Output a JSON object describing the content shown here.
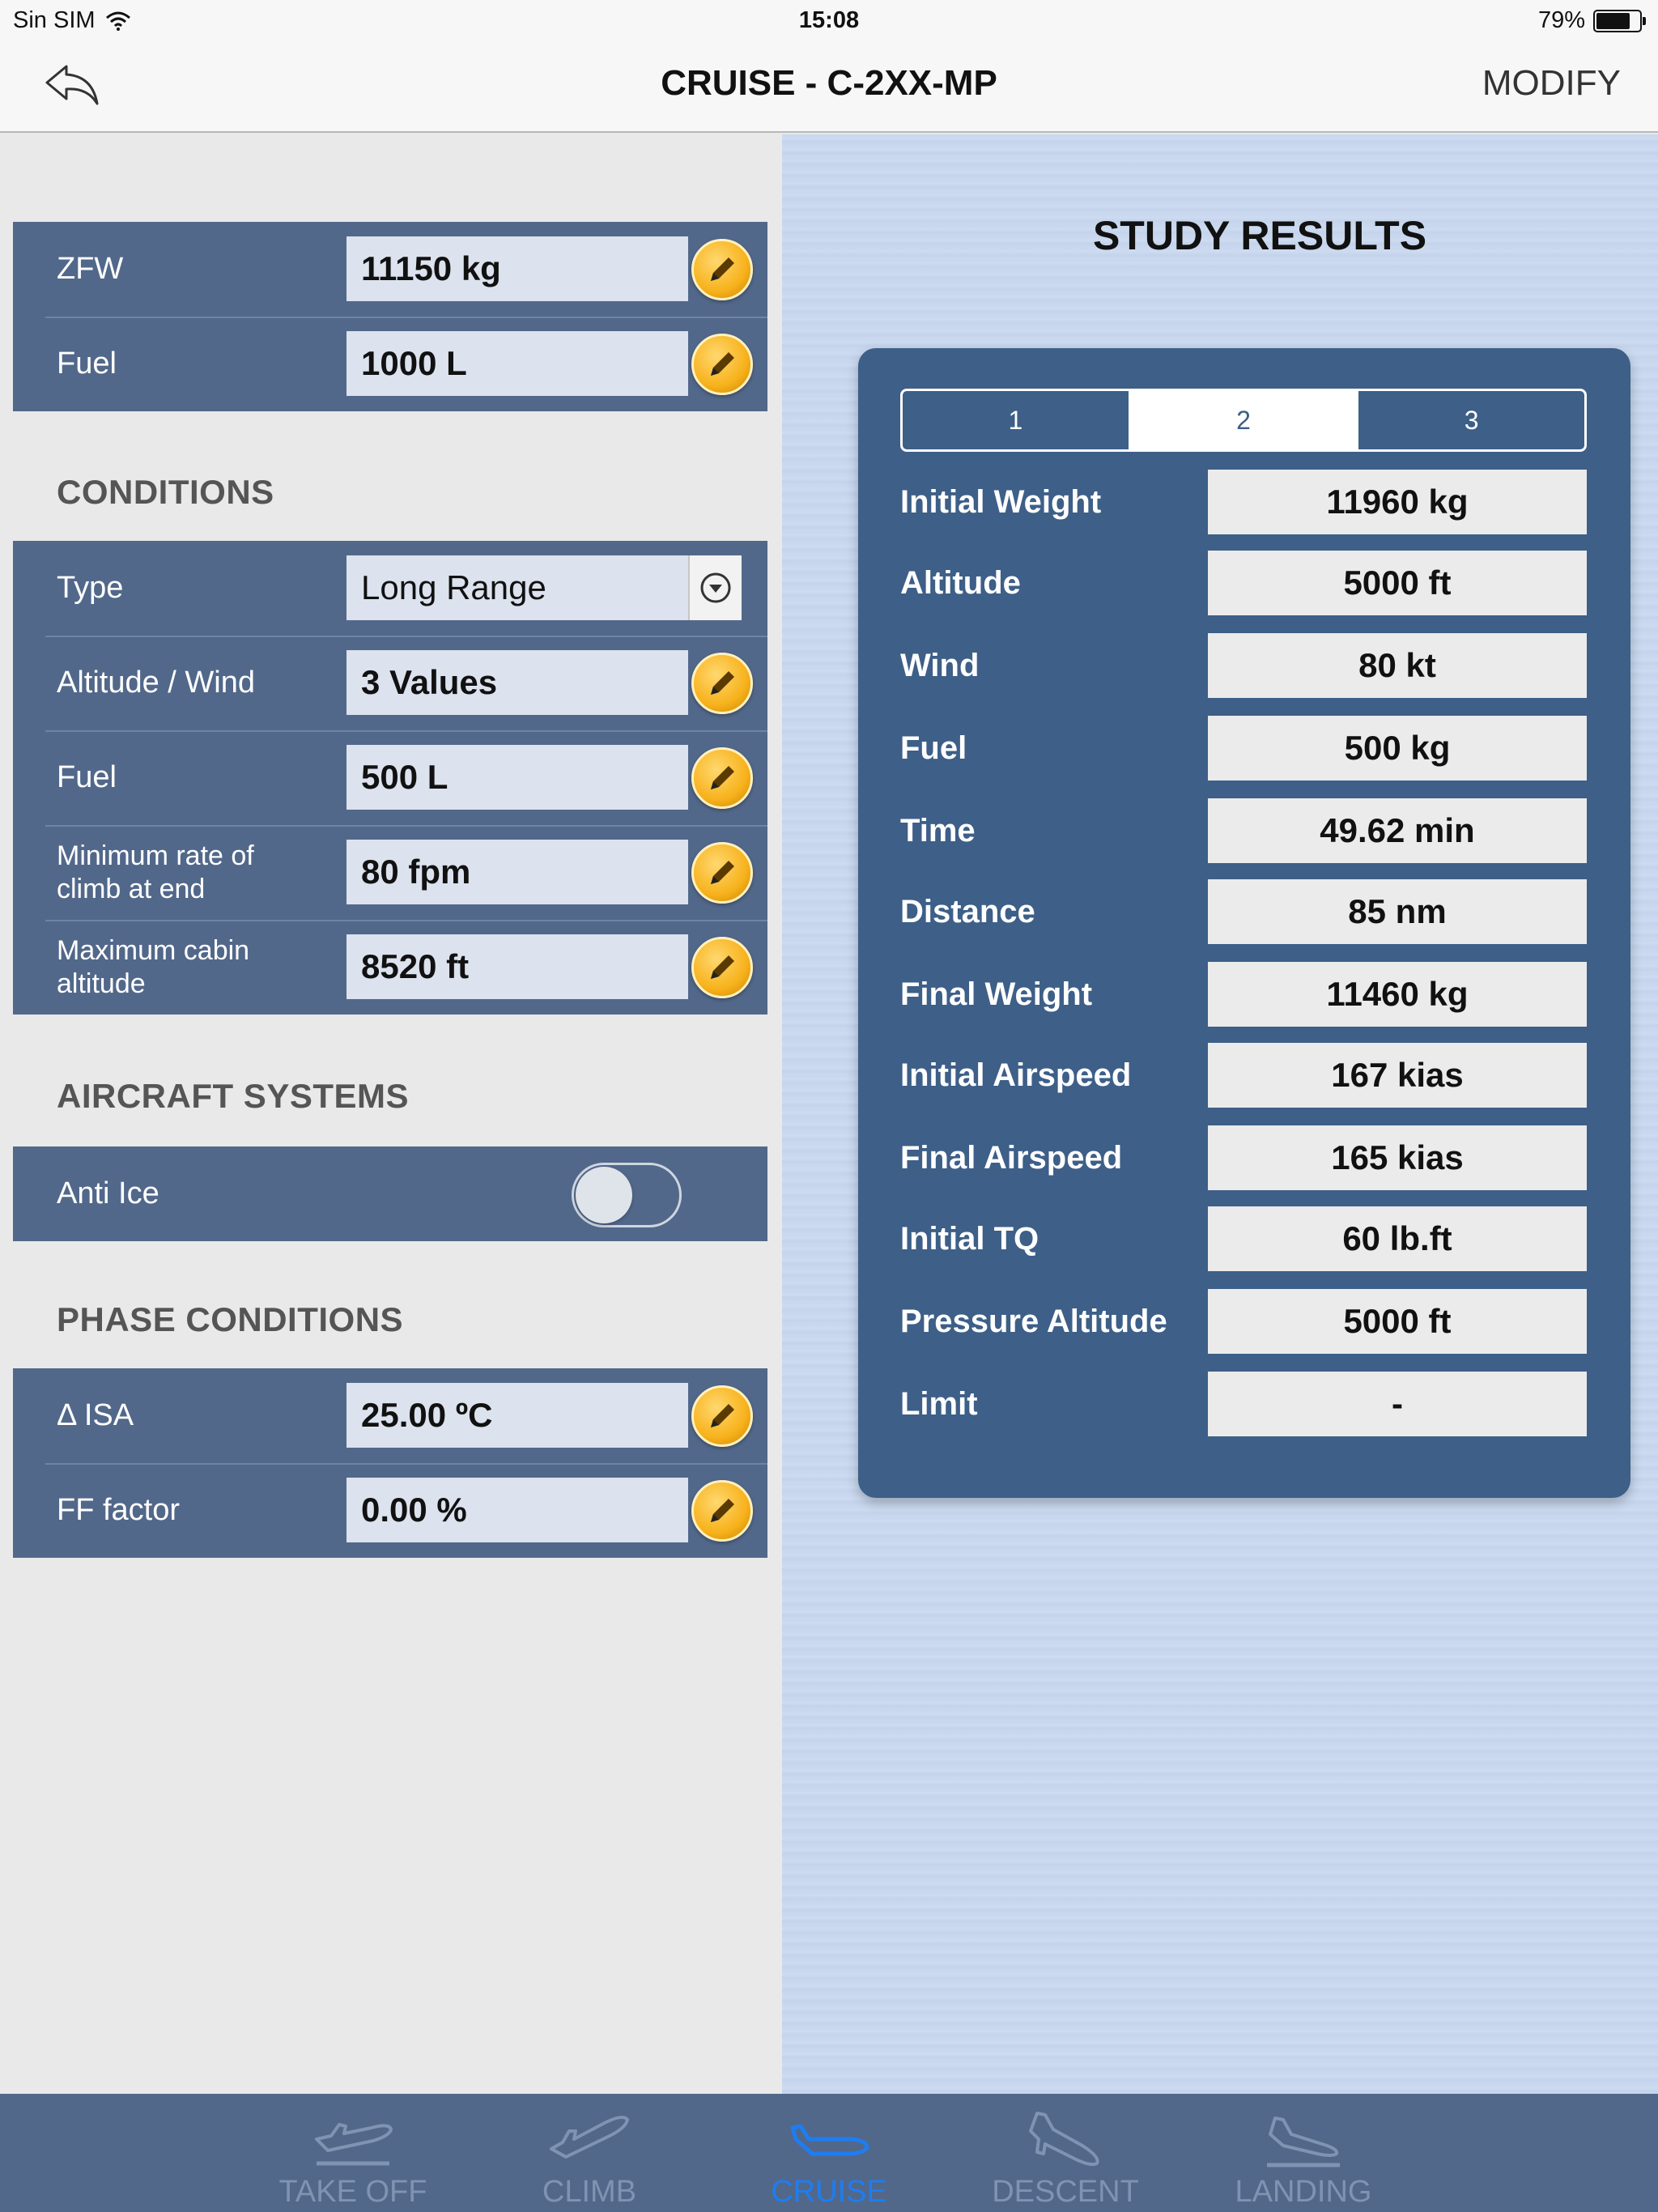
{
  "status": {
    "carrier": "Sin SIM",
    "time": "15:08",
    "battery": "79%",
    "battery_level": 0.79
  },
  "nav": {
    "title": "CRUISE - C-2XX-MP",
    "modify": "MODIFY"
  },
  "top_group": [
    {
      "label": "ZFW",
      "value": "11150 kg"
    },
    {
      "label": "Fuel",
      "value": "1000 L"
    }
  ],
  "conditions": {
    "title": "CONDITIONS",
    "type": {
      "label": "Type",
      "value": "Long Range"
    },
    "rows": [
      {
        "label": "Altitude / Wind",
        "value": "3 Values"
      },
      {
        "label": "Fuel",
        "value": "500 L"
      },
      {
        "label": "Minimum rate of climb at end",
        "value": "80 fpm"
      },
      {
        "label": "Maximum cabin altitude",
        "value": "8520 ft"
      }
    ]
  },
  "systems": {
    "title": "AIRCRAFT SYSTEMS",
    "anti_ice": {
      "label": "Anti Ice",
      "on": false
    }
  },
  "phase": {
    "title": "PHASE CONDITIONS",
    "rows": [
      {
        "label": "Δ ISA",
        "value": "25.00 ºC"
      },
      {
        "label": "FF factor",
        "value": "0.00 %"
      }
    ]
  },
  "results": {
    "title": "STUDY RESULTS",
    "segments": [
      "1",
      "2",
      "3"
    ],
    "selected_segment": "2",
    "rows": [
      {
        "label": "Initial Weight",
        "value": "11960 kg"
      },
      {
        "label": "Altitude",
        "value": "5000 ft"
      },
      {
        "label": "Wind",
        "value": "80 kt"
      },
      {
        "label": "Fuel",
        "value": "500 kg"
      },
      {
        "label": "Time",
        "value": "49.62 min"
      },
      {
        "label": "Distance",
        "value": "85 nm"
      },
      {
        "label": "Final Weight",
        "value": "11460 kg"
      },
      {
        "label": "Initial Airspeed",
        "value": "167 kias"
      },
      {
        "label": "Final Airspeed",
        "value": "165 kias"
      },
      {
        "label": "Initial TQ",
        "value": "60 lb.ft"
      },
      {
        "label": "Pressure Altitude",
        "value": "5000 ft"
      },
      {
        "label": "Limit",
        "value": "-"
      }
    ]
  },
  "tabs": [
    {
      "label": "TAKE OFF",
      "icon": "takeoff-icon"
    },
    {
      "label": "CLIMB",
      "icon": "climb-icon"
    },
    {
      "label": "CRUISE",
      "icon": "cruise-icon",
      "active": true
    },
    {
      "label": "DESCENT",
      "icon": "descent-icon"
    },
    {
      "label": "LANDING",
      "icon": "landing-icon"
    }
  ],
  "colors": {
    "panel": "#52688a",
    "results_panel": "#3d5f88",
    "accent": "#1e7df0",
    "edit_button": "#f7b21c"
  }
}
